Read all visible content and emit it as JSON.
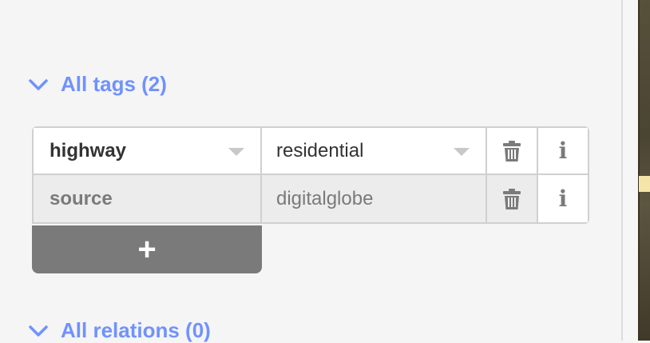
{
  "sections": {
    "all_tags": {
      "title": "All tags (2)"
    },
    "all_relations": {
      "title": "All relations (0)"
    }
  },
  "tags": [
    {
      "key": "highway",
      "value": "residential"
    },
    {
      "key": "source",
      "value": "digitalglobe"
    }
  ],
  "buttons": {
    "add_label": "+"
  },
  "icons": {
    "chevron": "chevron-down-icon",
    "delete": "trash-icon",
    "info": "info-icon",
    "combo": "caret-down-icon"
  },
  "colors": {
    "accent": "#7092ff",
    "button_gray": "#7a7a7a",
    "border": "#d0d0d0"
  }
}
